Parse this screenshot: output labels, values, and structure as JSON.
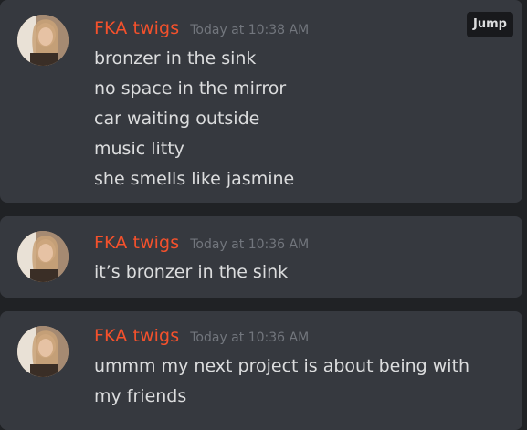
{
  "jump_label": "Jump",
  "messages": [
    {
      "author": "FKA twigs",
      "timestamp": "Today at 10:38 AM",
      "lines": [
        "bronzer in the sink",
        "no space in the mirror",
        "car waiting outside",
        "music litty",
        "she smells like jasmine"
      ]
    },
    {
      "author": "FKA twigs",
      "timestamp": "Today at 10:36 AM",
      "lines": [
        "it’s bronzer in the sink"
      ]
    },
    {
      "author": "FKA twigs",
      "timestamp": "Today at 10:36 AM",
      "lines": [
        "ummm my next project is about being with my friends"
      ]
    }
  ],
  "colors": {
    "author": "#f4512c",
    "timestamp": "#72767d",
    "text": "#dcddde",
    "card": "#36393f",
    "background": "#202225"
  },
  "icons": [
    "avatar-image"
  ]
}
